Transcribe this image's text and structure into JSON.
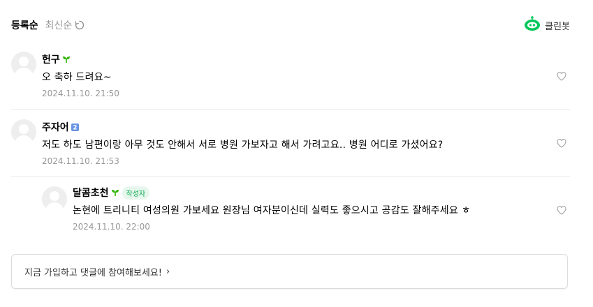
{
  "sort": {
    "active": "등록순",
    "inactive": "최신순"
  },
  "cleanbot": {
    "label": "클린봇"
  },
  "comments": [
    {
      "nick": "헌구",
      "badge": "sprout-icon",
      "text": "오 축하 드려요~",
      "date": "2024.11.10. 21:50"
    },
    {
      "nick": "주자어",
      "badge": "level-2-icon",
      "badge_text": "2",
      "text": "저도 하도 남편이랑 아무 것도 안해서 서로 병원 가보자고 해서 가려고요.. 병원 어디로 가셨어요?",
      "date": "2024.11.10. 21:53"
    },
    {
      "nick": "달콤초천",
      "badge": "sprout-icon",
      "writer_tag": "작성자",
      "text": "논현에 트리니티 여성의원 가보세요 원장님 여자분이신데 실력도 좋으시고 공감도 잘해주세요 ㅎ",
      "date": "2024.11.10. 22:00",
      "reply": true
    }
  ],
  "join": {
    "text": "지금 가입하고 댓글에 참여해보세요!",
    "arrow": "›"
  },
  "colors": {
    "accent": "#03c75a",
    "writer_tag": "#03a94d",
    "meta": "#979797"
  }
}
